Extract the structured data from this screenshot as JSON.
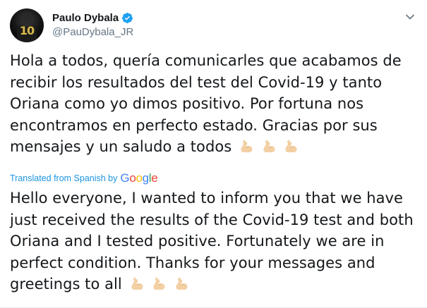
{
  "tweet": {
    "author": {
      "display_name": "Paulo Dybala",
      "handle": "@PauDybala_JR",
      "verified": true,
      "avatar_number": "10"
    },
    "original_text": "Hola a todos, quería comunicarles que acabamos de recibir los resultados del test del Covid-19 y tanto Oriana como yo dimos positivo. Por fortuna nos encontramos en perfecto estado. Gracias por sus mensajes y un saludo a todos",
    "original_lines": [
      "Hola a todos, quería comunicarles que acabamos de",
      "recibir los resultados del test del Covid-19 y tanto",
      "Oriana como yo dimos positivo. Por fortuna nos",
      "encontramos en perfecto estado. Gracias por sus",
      "mensajes y un saludo a todos"
    ],
    "translated_by_label": "Translated from Spanish by",
    "translator_brand": "Google",
    "translation_lines": [
      "Hello everyone, I wanted to inform you that we have",
      "just received the results of the Covid-19 test and both",
      "Oriana and I tested positive. Fortunately we are in",
      "perfect condition. Thanks for your messages and",
      "greetings to all"
    ],
    "emoji": "flexed-biceps",
    "emoji_count": 3
  },
  "colors": {
    "text": "#14171a",
    "secondary": "#657786",
    "link": "#1b95e0",
    "verified": "#1da1f2",
    "emoji_skin": "#f2d0a4"
  },
  "icons": {
    "verified": "verified-badge-icon",
    "menu": "chevron-down-icon",
    "emoji": "flexed-biceps-icon"
  }
}
